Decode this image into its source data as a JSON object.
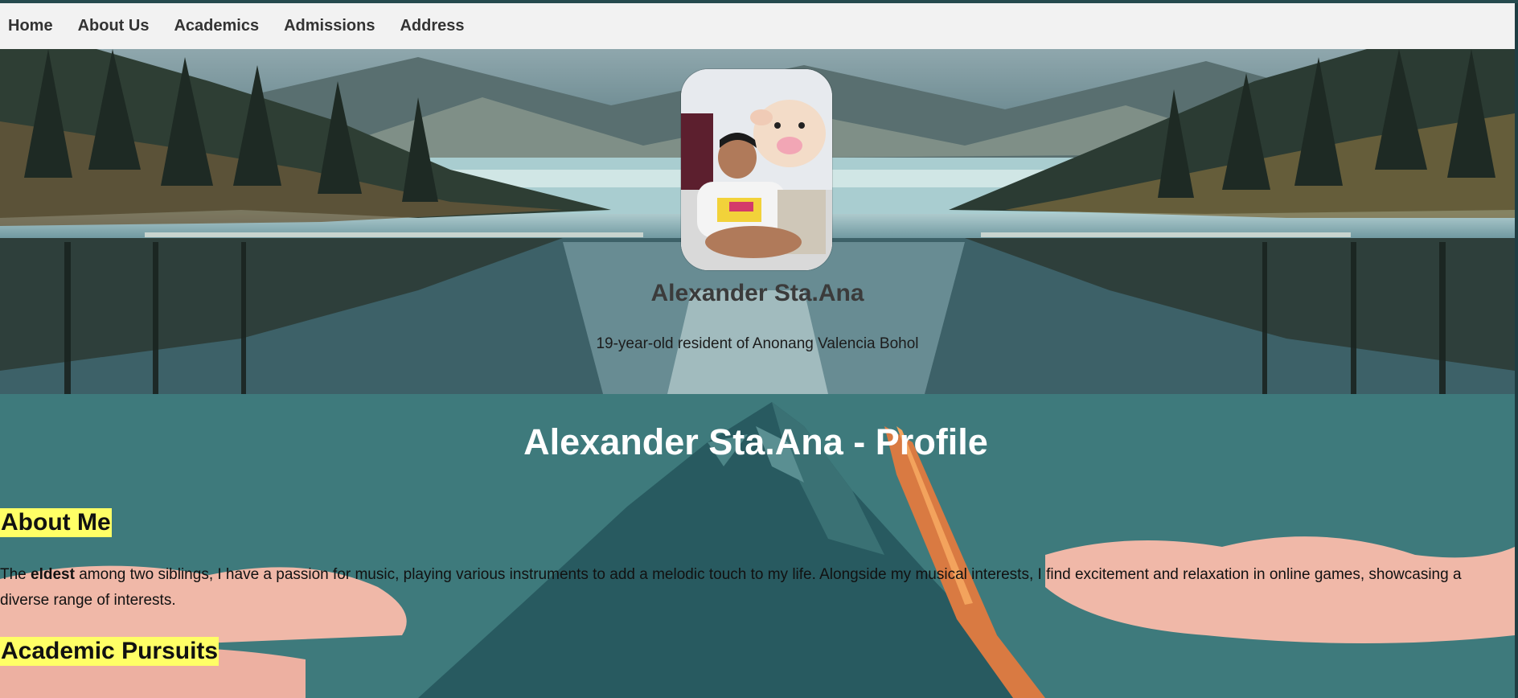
{
  "nav": {
    "items": [
      "Home",
      "About Us",
      "Academics",
      "Admissions",
      "Address"
    ]
  },
  "hero": {
    "name": "Alexander Sta.Ana",
    "subtitle": "19-year-old resident of Anonang Valencia Bohol"
  },
  "profile": {
    "title": "Alexander Sta.Ana - Profile",
    "about_heading": "About Me",
    "about_prefix": "The ",
    "about_bold": "eldest",
    "about_rest": " among two siblings, I have a passion for music, playing various instruments to add a melodic touch to my life. Alongside my musical interests, I find excitement and relaxation in online games, showcasing a diverse range of interests.",
    "academic_heading": "Academic Pursuits"
  },
  "colors": {
    "nav_bg": "#f2f2f2",
    "heading_highlight": "#ffff66",
    "content_bg": "#3e7a7c"
  }
}
